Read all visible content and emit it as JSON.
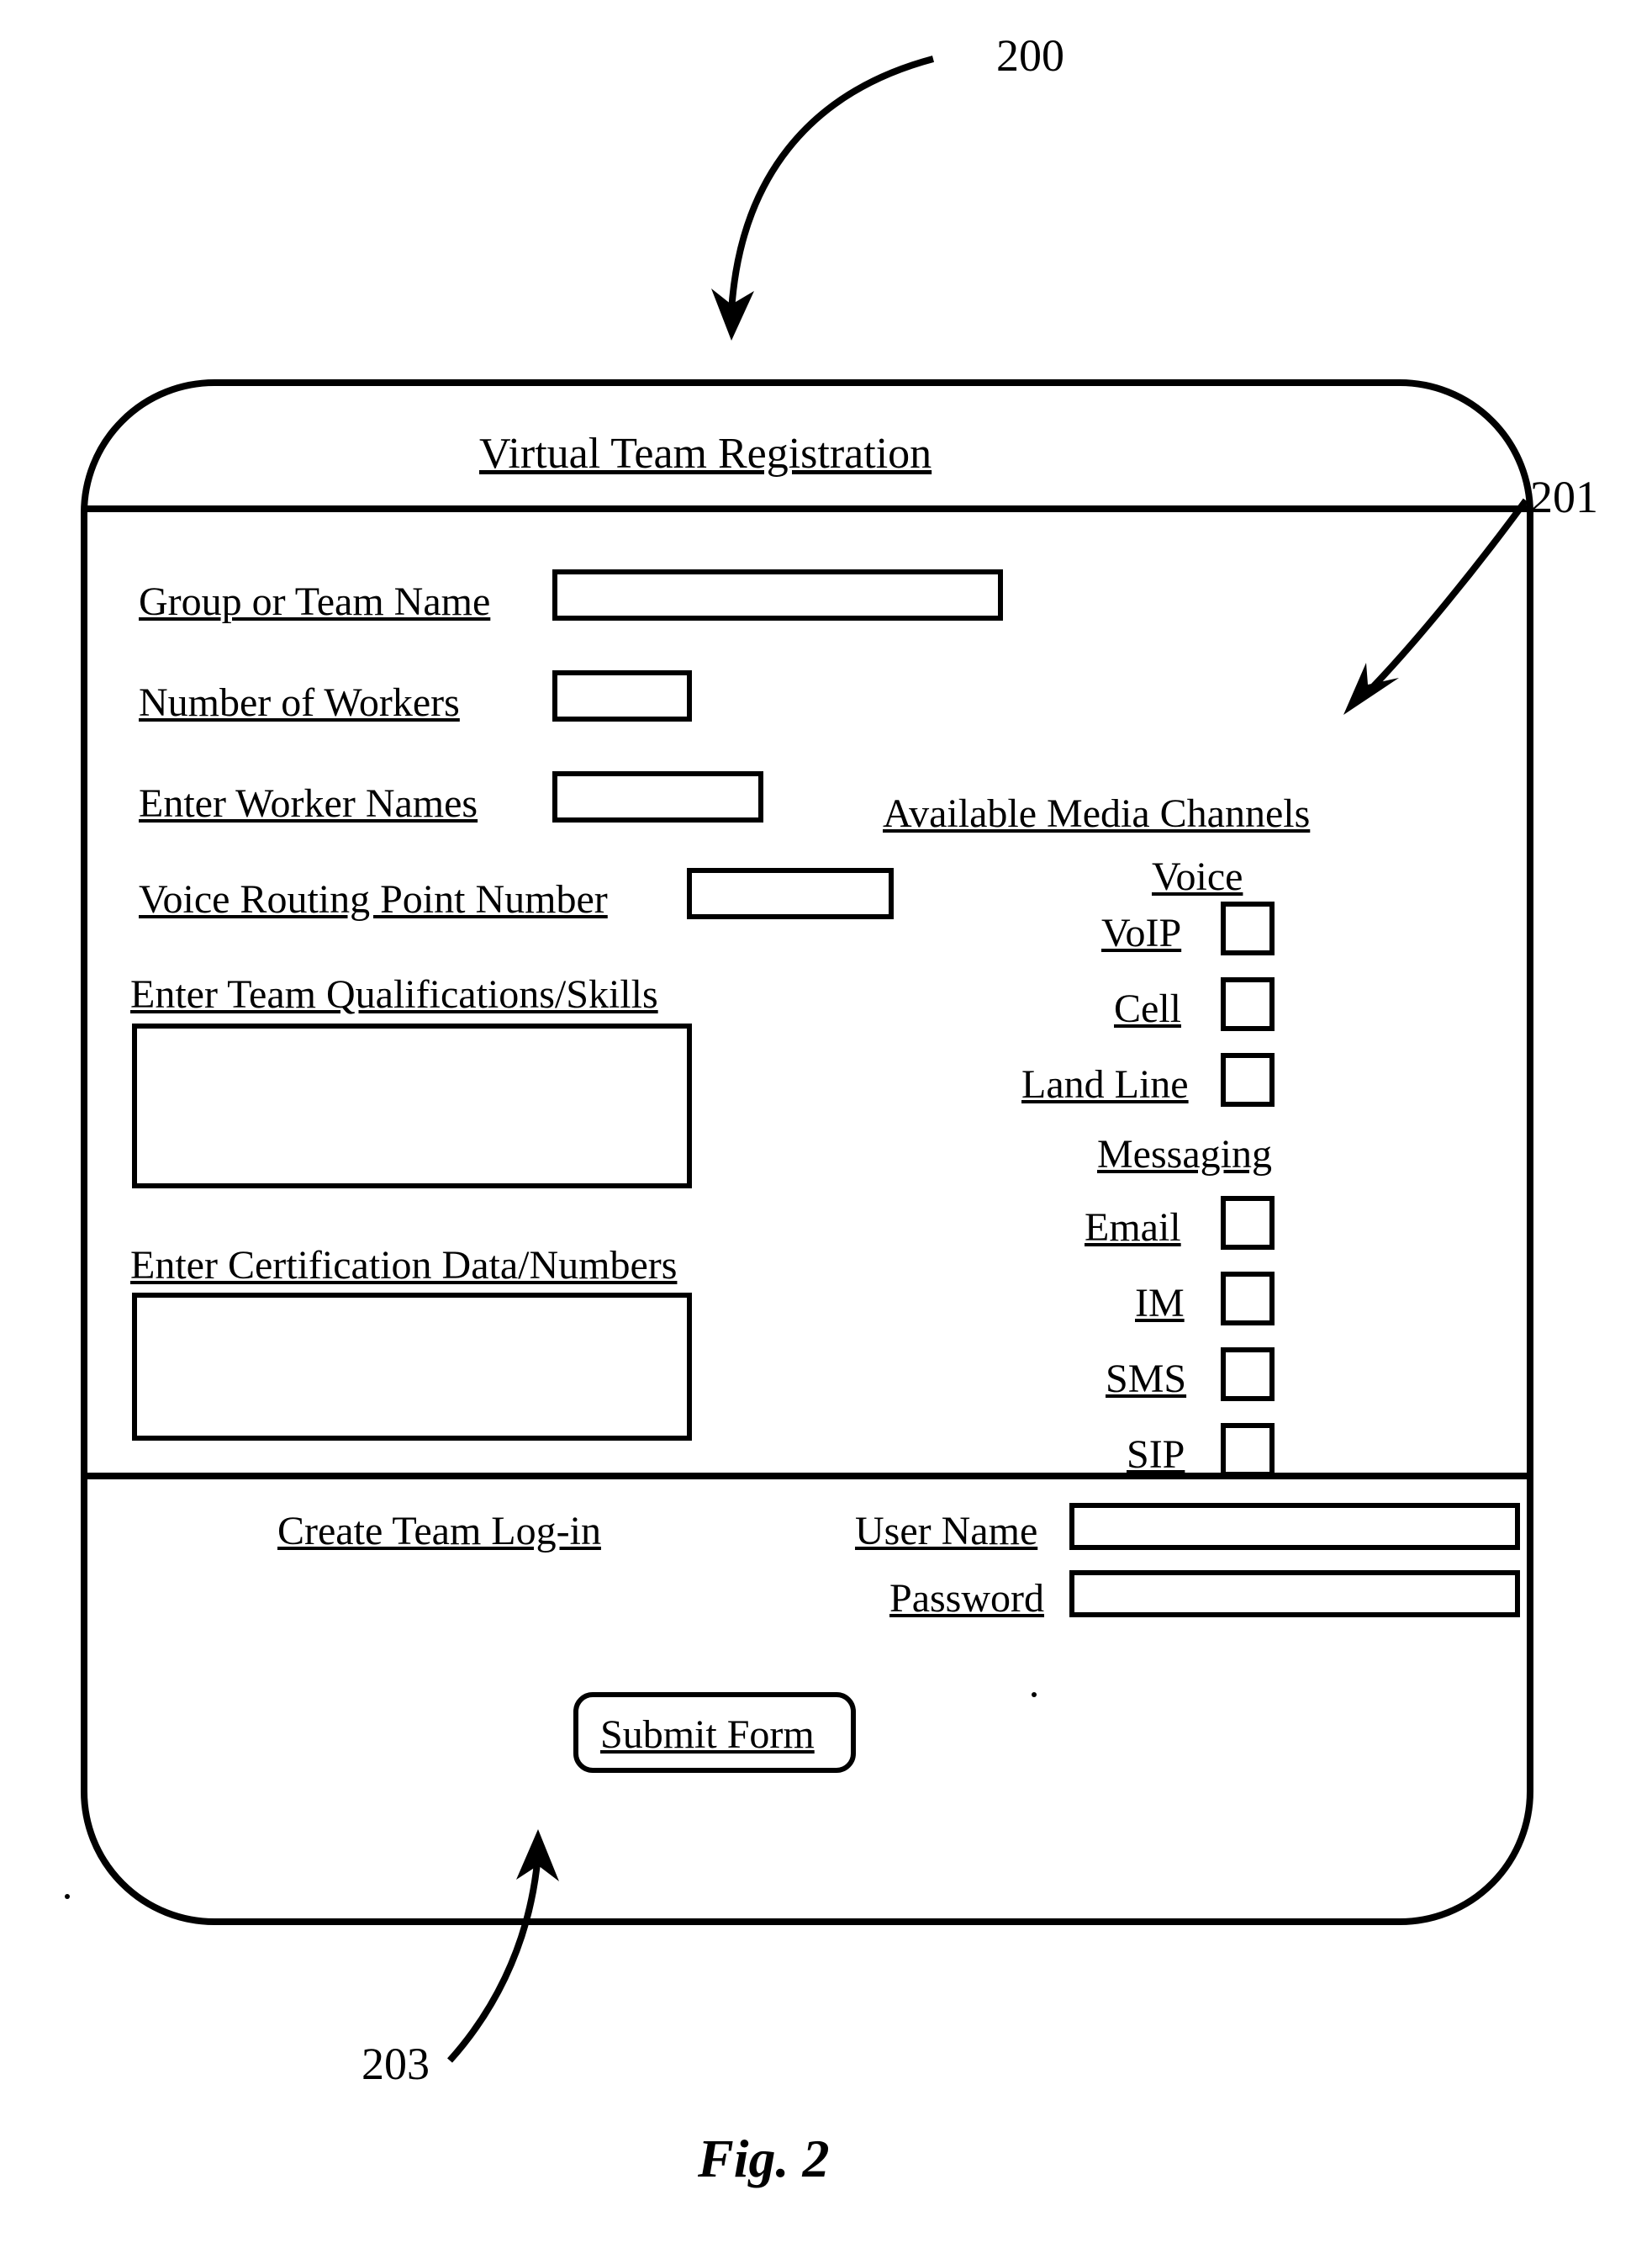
{
  "callouts": {
    "c200": "200",
    "c201": "201",
    "c203": "203"
  },
  "header": {
    "title": "Virtual Team Registration"
  },
  "fields": {
    "group": {
      "label": "Group or Team Name"
    },
    "workers": {
      "label": "Number of Workers"
    },
    "names": {
      "label": "Enter Worker Names"
    },
    "routing": {
      "label": "Voice Routing Point Number"
    },
    "skills": {
      "label": "Enter Team Qualifications/Skills"
    },
    "cert": {
      "label": "Enter Certification Data/Numbers"
    }
  },
  "channels": {
    "heading": "Available Media Channels",
    "voice": {
      "heading": "Voice",
      "options": {
        "voip": {
          "label": "VoIP"
        },
        "cell": {
          "label": "Cell"
        },
        "land": {
          "label": "Land Line"
        }
      }
    },
    "msg": {
      "heading": "Messaging",
      "options": {
        "email": {
          "label": "Email"
        },
        "im": {
          "label": "IM"
        },
        "sms": {
          "label": "SMS"
        },
        "sip": {
          "label": "SIP"
        }
      }
    }
  },
  "login": {
    "heading": "Create Team Log-in",
    "username": {
      "label": "User Name"
    },
    "password": {
      "label": "Password"
    }
  },
  "submit": {
    "label": "Submit Form"
  },
  "figure": {
    "caption": "Fig. 2"
  }
}
